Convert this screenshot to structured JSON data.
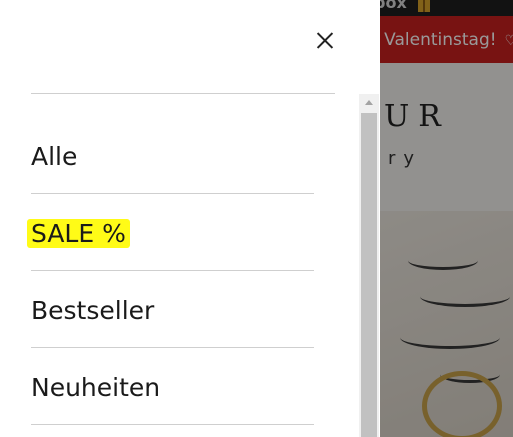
{
  "background_page": {
    "topbar_text": "box",
    "banner_text": "n Valentinstag!",
    "logo_text": "UR",
    "logo_subtext": "ry"
  },
  "drawer": {
    "menu_items": [
      {
        "label": "Alle",
        "highlighted": false
      },
      {
        "label": "SALE %",
        "highlighted": true
      },
      {
        "label": "Bestseller",
        "highlighted": false
      },
      {
        "label": "Neuheiten",
        "highlighted": false
      }
    ]
  },
  "colors": {
    "banner": "#c9211f",
    "highlight": "#fffb17",
    "overlay": "rgba(0,0,0,0.40)"
  },
  "icons": [
    "close-icon",
    "gift-icon",
    "heart-icon",
    "scroll-up-arrow-icon"
  ]
}
